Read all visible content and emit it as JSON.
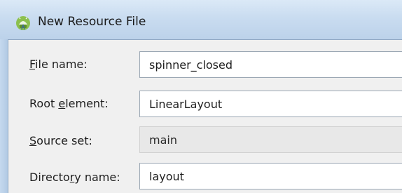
{
  "window": {
    "title": "New Resource File",
    "icon": "android-studio-icon"
  },
  "form": {
    "file_name_label_mnemonic": "F",
    "file_name_label_rest": "ile name:",
    "file_name_value": "spinner_closed",
    "root_element_label_pre": "Root ",
    "root_element_label_mnemonic": "e",
    "root_element_label_post": "lement:",
    "root_element_value": "LinearLayout",
    "source_set_label_mnemonic": "S",
    "source_set_label_rest": "ource set:",
    "source_set_value": "main",
    "directory_name_label_pre": "Directo",
    "directory_name_label_mnemonic": "r",
    "directory_name_label_post": "y name:",
    "directory_name_value": "layout"
  }
}
